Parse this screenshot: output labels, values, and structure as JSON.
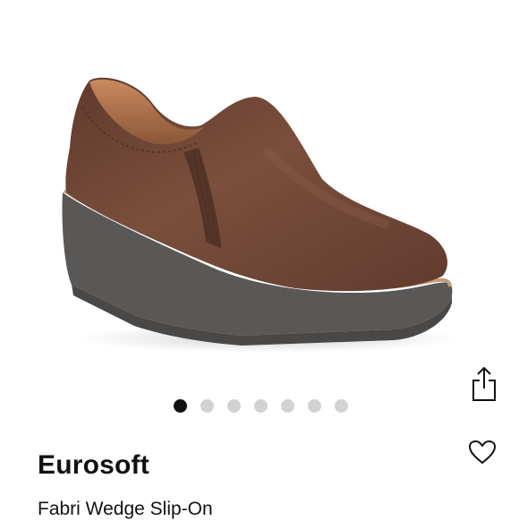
{
  "product": {
    "brand": "Eurosoft",
    "name": "Fabri Wedge Slip-On"
  },
  "gallery": {
    "image_count": 7,
    "active_index": 0
  },
  "icons": {
    "share": "share-icon",
    "favorite": "heart-icon"
  },
  "colors": {
    "leather": "#6b4434",
    "sole": "#5a5856",
    "dot_active": "#111111",
    "dot_inactive": "#d2d2d2"
  }
}
